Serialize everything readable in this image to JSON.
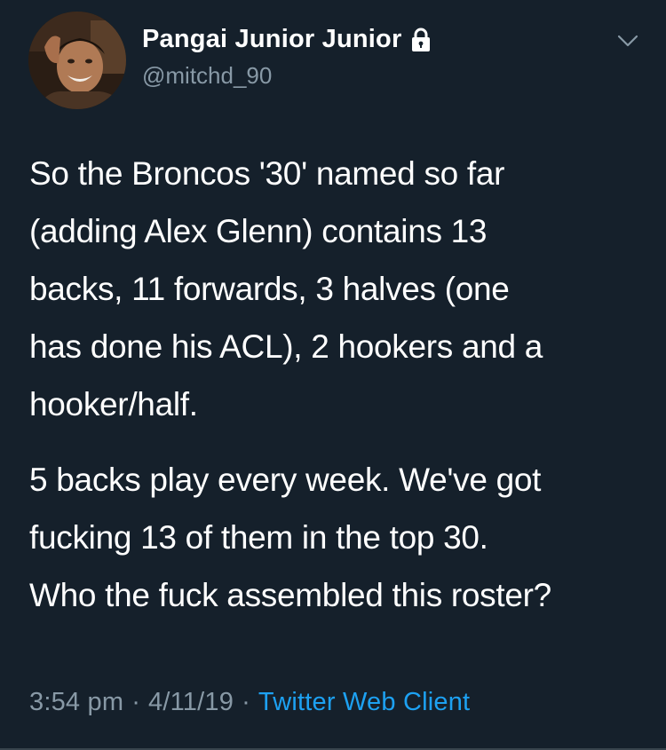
{
  "tweet": {
    "author": {
      "display_name": "Pangai Junior Junior",
      "handle": "@mitchd_90",
      "avatar_icon": "profile-photo",
      "protected_icon": "lock-icon"
    },
    "menu_icon": "chevron-down-icon",
    "paragraphs": [
      {
        "lines": [
          "So the Broncos '30' named so far",
          "(adding Alex Glenn) contains 13",
          "backs, 11 forwards, 3 halves (one",
          "has done his ACL), 2 hookers and a",
          "hooker/half."
        ]
      },
      {
        "lines": [
          "5 backs play every week. We've got",
          "fucking 13 of them in the top 30.",
          "Who the fuck assembled this roster?"
        ]
      }
    ],
    "time": "3:54 pm",
    "date": "4/11/19",
    "separator": "·",
    "client": "Twitter Web Client"
  },
  "colors": {
    "background": "#15202b",
    "text": "#ffffff",
    "secondary": "#8899a6",
    "link": "#1da1f2"
  }
}
